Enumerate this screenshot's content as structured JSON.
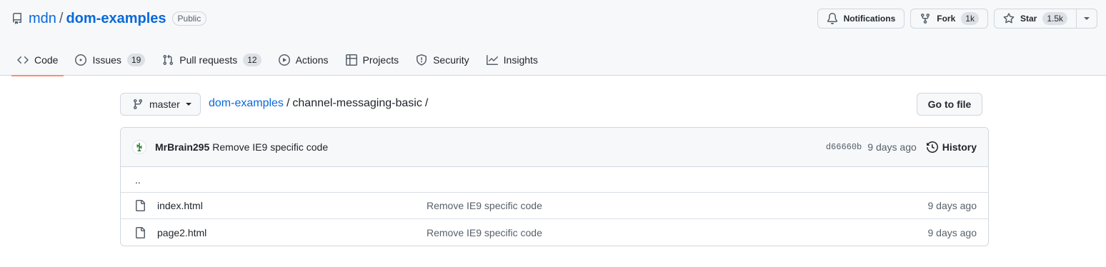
{
  "repo": {
    "owner": "mdn",
    "separator": "/",
    "name": "dom-examples",
    "visibility": "Public"
  },
  "header_actions": {
    "notifications": "Notifications",
    "fork": {
      "label": "Fork",
      "count": "1k"
    },
    "star": {
      "label": "Star",
      "count": "1.5k"
    }
  },
  "tabs": [
    {
      "label": "Code",
      "icon": "code-icon",
      "selected": true
    },
    {
      "label": "Issues",
      "count": "19",
      "icon": "issue-icon"
    },
    {
      "label": "Pull requests",
      "count": "12",
      "icon": "pull-request-icon"
    },
    {
      "label": "Actions",
      "icon": "play-icon"
    },
    {
      "label": "Projects",
      "icon": "table-icon"
    },
    {
      "label": "Security",
      "icon": "shield-icon"
    },
    {
      "label": "Insights",
      "icon": "graph-icon"
    }
  ],
  "branch": "master",
  "breadcrumb": {
    "root": "dom-examples",
    "sep1": "/",
    "current": "channel-messaging-basic",
    "sep2": "/"
  },
  "go_to_file": "Go to file",
  "latest_commit": {
    "author": "MrBrain295",
    "message": "Remove IE9 specific code",
    "sha": "d66660b",
    "age": "9 days ago",
    "history": "History"
  },
  "parent_dir": "..",
  "files": [
    {
      "name": "index.html",
      "message": "Remove IE9 specific code",
      "age": "9 days ago"
    },
    {
      "name": "page2.html",
      "message": "Remove IE9 specific code",
      "age": "9 days ago"
    }
  ],
  "colors": {
    "link": "#0969da",
    "tab_underline": "#fd8c73",
    "header_bg": "#f6f8fa",
    "border": "#d0d7de"
  }
}
